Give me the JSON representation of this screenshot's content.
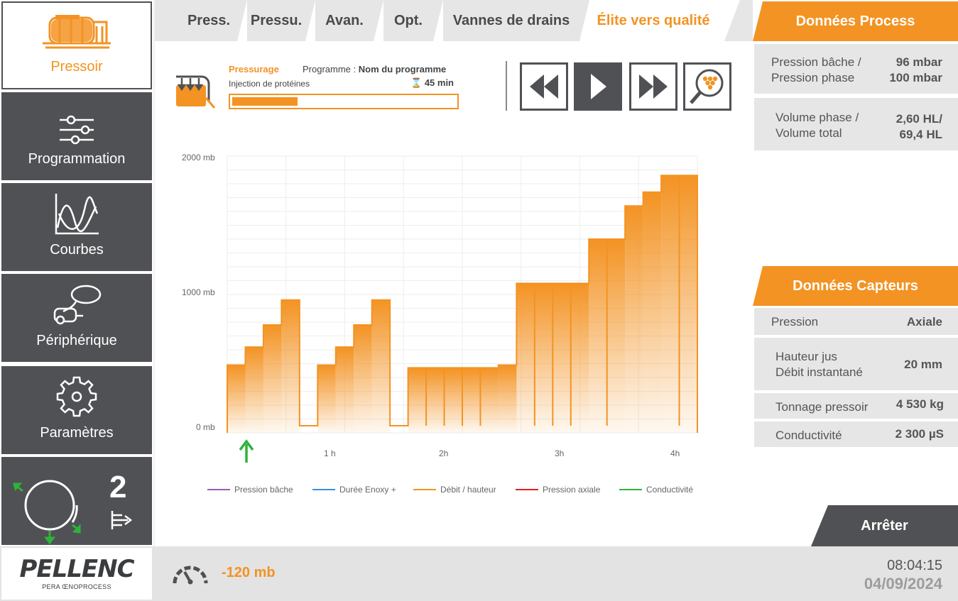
{
  "sidebar": {
    "items": [
      {
        "label": "Pressoir",
        "icon": "press-machine-icon"
      },
      {
        "label": "Programmation",
        "icon": "sliders-icon"
      },
      {
        "label": "Courbes",
        "icon": "curves-icon"
      },
      {
        "label": "Périphérique",
        "icon": "peripheral-icon"
      },
      {
        "label": "Paramètres",
        "icon": "gear-icon"
      }
    ],
    "status_count": "2"
  },
  "tabs": [
    "Press.",
    "Pressu.",
    "Avan.",
    "Opt.",
    "Vannes de drains",
    "Élite vers qualité"
  ],
  "program": {
    "phase": "Pressurage",
    "label_prefix": "Programme : ",
    "name": "Nom du programme",
    "step": "Injection de protéines",
    "time": "45 min",
    "progress": 0.29
  },
  "controls": [
    "rewind-icon",
    "play-icon",
    "fast-forward-icon",
    "search-grapes-icon"
  ],
  "chart_data": {
    "type": "bar",
    "y_ticks": [
      "2000 mb",
      "1000 mb",
      "0 mb"
    ],
    "x_ticks": [
      "1 h",
      "2h",
      "3h",
      "4h"
    ],
    "ylim": [
      0,
      2000
    ],
    "y_unit": "mb",
    "grid": true,
    "legend_position": "bottom",
    "series": [
      {
        "name": "Pression bâche",
        "color": "#9b59b6",
        "values": []
      },
      {
        "name": "Durée Enoxy +",
        "color": "#3a8fd8",
        "values": []
      },
      {
        "name": "Débit / hauteur",
        "color": "#f39323",
        "values": [
          490,
          620,
          780,
          960,
          0,
          490,
          620,
          780,
          960,
          0,
          470,
          470,
          470,
          470,
          470,
          490,
          1080,
          1080,
          1080,
          1080,
          1400,
          1400,
          1640,
          1740,
          1860,
          1860
        ]
      },
      {
        "name": "Pression axiale",
        "color": "#e02020",
        "values": []
      },
      {
        "name": "Conductivité",
        "color": "#2db33a",
        "values": []
      }
    ]
  },
  "process": {
    "title": "Données Process",
    "rows": [
      {
        "label1": "Pression bâche /",
        "label2": "Pression phase",
        "val1": "96 mbar",
        "val2": "100 mbar"
      },
      {
        "label1": "Volume phase /",
        "label2": "Volume total",
        "val1": "2,60 HL/",
        "val2": "69,4 HL"
      }
    ]
  },
  "sensors": {
    "title": "Données Capteurs",
    "rows": [
      {
        "label": "Pression",
        "value": "Axiale"
      },
      {
        "label1": "Hauteur jus",
        "label2": "Débit instantané",
        "value": "20 mm"
      },
      {
        "label": "Tonnage pressoir",
        "value": "4 530 kg"
      },
      {
        "label": "Conductivité",
        "value": "2 300 µS"
      }
    ]
  },
  "stop_label": "Arrêter",
  "footer": {
    "logo": "PELLENC",
    "logo_sub": "PERA ŒNOPROCESS",
    "gauge_value": "-120 mb",
    "time": "08:04:15",
    "date": "04/09/2024"
  },
  "colors": {
    "accent": "#f39323",
    "dark": "#505154",
    "arrow_green": "#2db33a"
  }
}
